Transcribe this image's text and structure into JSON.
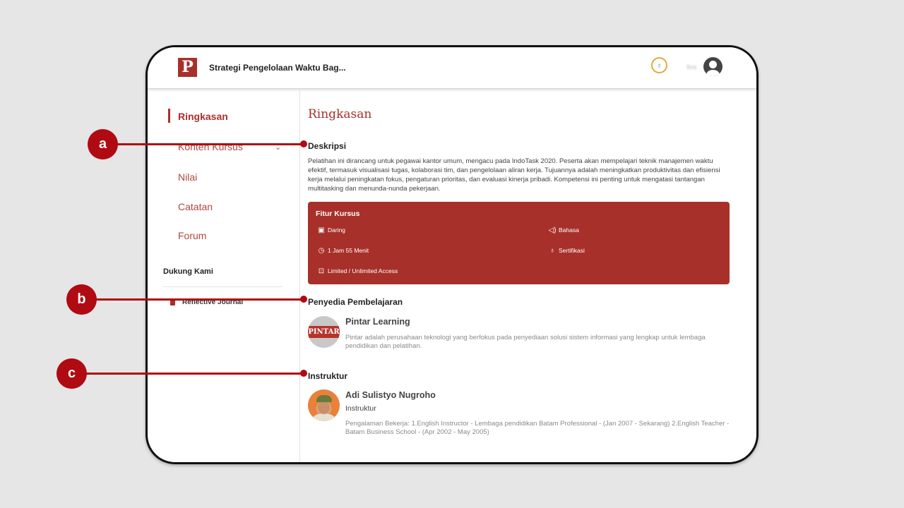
{
  "header": {
    "logo_letter": "P",
    "course_title": "Strategi Pengelolaan Waktu Bag...",
    "user_name": "Ilva"
  },
  "sidebar": {
    "items": [
      {
        "label": "Ringkasan",
        "active": true
      },
      {
        "label": "Konten Kursus"
      },
      {
        "label": "Nilai"
      },
      {
        "label": "Catatan"
      },
      {
        "label": "Forum"
      }
    ],
    "support_title": "Dukung Kami",
    "journal_label": "Reflective Journal"
  },
  "main": {
    "page_title": "Ringkasan",
    "description_title": "Deskripsi",
    "description_text": "Pelatihan ini dirancang untuk pegawai kantor umum, mengacu pada IndoTask 2020. Peserta akan mempelajari teknik manajemen waktu efektif, termasuk visualisasi tugas, kolaborasi tim, dan pengelolaan aliran kerja. Tujuannya adalah meningkatkan produktivitas dan efisiensi kerja melalui peningkatan fokus, pengaturan prioritas, dan evaluasi kinerja pribadi. Kompetensi ini penting untuk mengatasi tantangan multitasking dan menunda-nunda pekerjaan.",
    "features": {
      "title": "Fitur Kursus",
      "items": [
        {
          "label": "Daring",
          "icon": "monitor-icon"
        },
        {
          "label": "Bahasa",
          "icon": "speaker-icon"
        },
        {
          "label": "1 Jam 55 Menit",
          "icon": "clock-icon"
        },
        {
          "label": "Sertifikasi",
          "icon": "award-icon"
        },
        {
          "label": "Limited / Unlimited Access",
          "icon": "lock-icon"
        }
      ]
    },
    "provider": {
      "section_title": "Penyedia Pembelajaran",
      "logo_text": "PINTAR",
      "name": "Pintar Learning",
      "description": "Pintar adalah perusahaan teknologi yang berfokus pada penyediaan solusi sistem informasi yang lengkap untuk lembaga pendidikan dan pelatihan."
    },
    "instructor": {
      "section_title": "Instruktur",
      "name": "Adi Sulistyo Nugroho",
      "role": "Instruktur",
      "experience": "Pengalaman Bekerja: 1.English Instructor - Lembaga pendidikan Batam Professional - (Jan 2007 - Sekarang) 2.English Teacher - Batam Business School - (Apr 2002 - May 2005)"
    }
  },
  "callouts": [
    {
      "label": "a"
    },
    {
      "label": "b"
    },
    {
      "label": "c"
    }
  ],
  "colors": {
    "brand": "#a8302a",
    "callout": "#b00a12",
    "badge_ring": "#e7a83b"
  }
}
